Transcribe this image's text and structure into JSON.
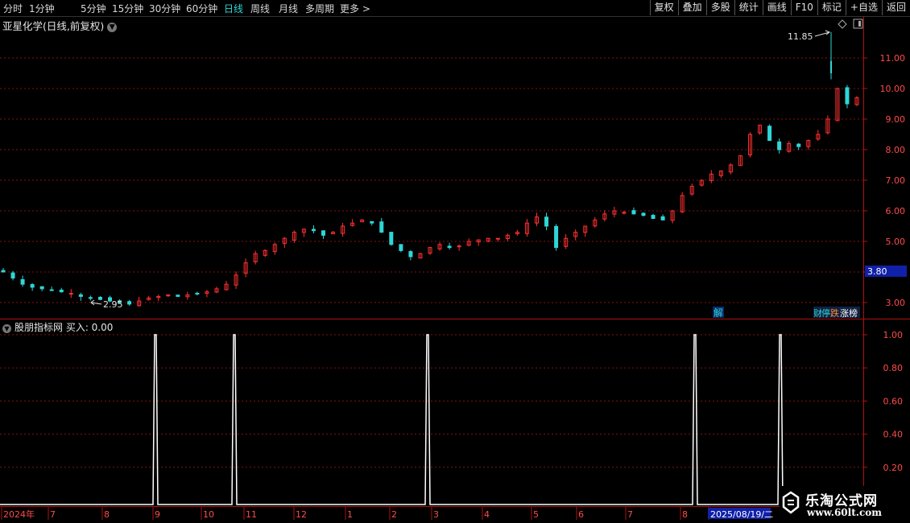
{
  "toolbar": {
    "periods": [
      "分时",
      "1分钟",
      "5分钟",
      "15分钟",
      "30分钟",
      "60分钟",
      "日线",
      "周线",
      "月线",
      "多周期",
      "更多 >"
    ],
    "active_period": "日线",
    "tools": [
      "复权",
      "叠加",
      "多股",
      "统计",
      "画线",
      "F10",
      "标记",
      "+自选",
      "返回"
    ]
  },
  "chart_title": "亚星化学(日线,前复权)",
  "indicator_title": "股朋指标网 买入: 0.00",
  "colors": {
    "up": "#ff3030",
    "down": "#2fd6d6",
    "grid": "#8a1010",
    "axis": "#b01010",
    "signal": "#ffffff",
    "accent": "#2fd6d6"
  },
  "price_axis": {
    "ticks": [
      "3.00",
      "4.00",
      "5.00",
      "6.00",
      "7.00",
      "8.00",
      "9.00",
      "10.00",
      "11.00"
    ],
    "current_price_label": "3.80"
  },
  "indicator_axis": {
    "ticks": [
      "0.20",
      "0.40",
      "0.60",
      "0.80",
      "1.00"
    ]
  },
  "annotations": {
    "high_label": "11.85",
    "low_label": "2.95"
  },
  "event_badges": [
    "解",
    "财",
    "停",
    "跌",
    "涨榜"
  ],
  "time_axis": {
    "labels": [
      "2024年",
      "7",
      "8",
      "9",
      "10",
      "11",
      "12",
      "1",
      "2",
      "3",
      "4",
      "5",
      "6",
      "7",
      "8",
      "2025/08/19/二",
      "1"
    ]
  },
  "chart_data": [
    {
      "type": "candlestick",
      "title": "亚星化学(日线,前复权)",
      "ylim": [
        2.5,
        12.0
      ],
      "close_series_approx": [
        4.0,
        3.8,
        3.6,
        3.5,
        3.45,
        3.4,
        3.35,
        3.3,
        3.2,
        3.15,
        3.1,
        3.05,
        3.0,
        2.95,
        3.05,
        3.15,
        3.2,
        3.25,
        3.2,
        3.25,
        3.3,
        3.35,
        3.45,
        3.6,
        3.9,
        4.3,
        4.6,
        4.7,
        4.9,
        5.1,
        5.3,
        5.4,
        5.35,
        5.2,
        5.3,
        5.5,
        5.6,
        5.7,
        5.6,
        5.3,
        4.9,
        4.7,
        4.5,
        4.6,
        4.8,
        4.9,
        4.8,
        4.85,
        5.0,
        5.05,
        5.1,
        5.1,
        5.2,
        5.3,
        5.6,
        5.8,
        5.5,
        4.8,
        5.1,
        5.3,
        5.5,
        5.7,
        5.9,
        6.0,
        5.95,
        5.9,
        5.85,
        5.75,
        5.7,
        6.0,
        6.5,
        6.8,
        7.0,
        7.2,
        7.3,
        7.5,
        7.8,
        8.5,
        8.8,
        8.3,
        8.0,
        8.2,
        8.1,
        8.3,
        8.5,
        9.0,
        10.0,
        9.5,
        9.7
      ],
      "high": 11.85,
      "low": 2.95,
      "last": 9.3
    },
    {
      "type": "bar",
      "title": "股朋指标网 买入",
      "ylim": [
        0,
        1.05
      ],
      "signals": [
        {
          "x": "2024-09",
          "value": 1.0
        },
        {
          "x": "2024-10",
          "value": 1.0
        },
        {
          "x": "2025-03",
          "value": 1.0
        },
        {
          "x": "2025-08",
          "value": 1.0
        },
        {
          "x": "2025-08",
          "value": 1.0
        }
      ],
      "last_value": 0.0
    }
  ],
  "watermark": {
    "line1": "乐淘公式网",
    "line2": "www.60lt.com"
  }
}
